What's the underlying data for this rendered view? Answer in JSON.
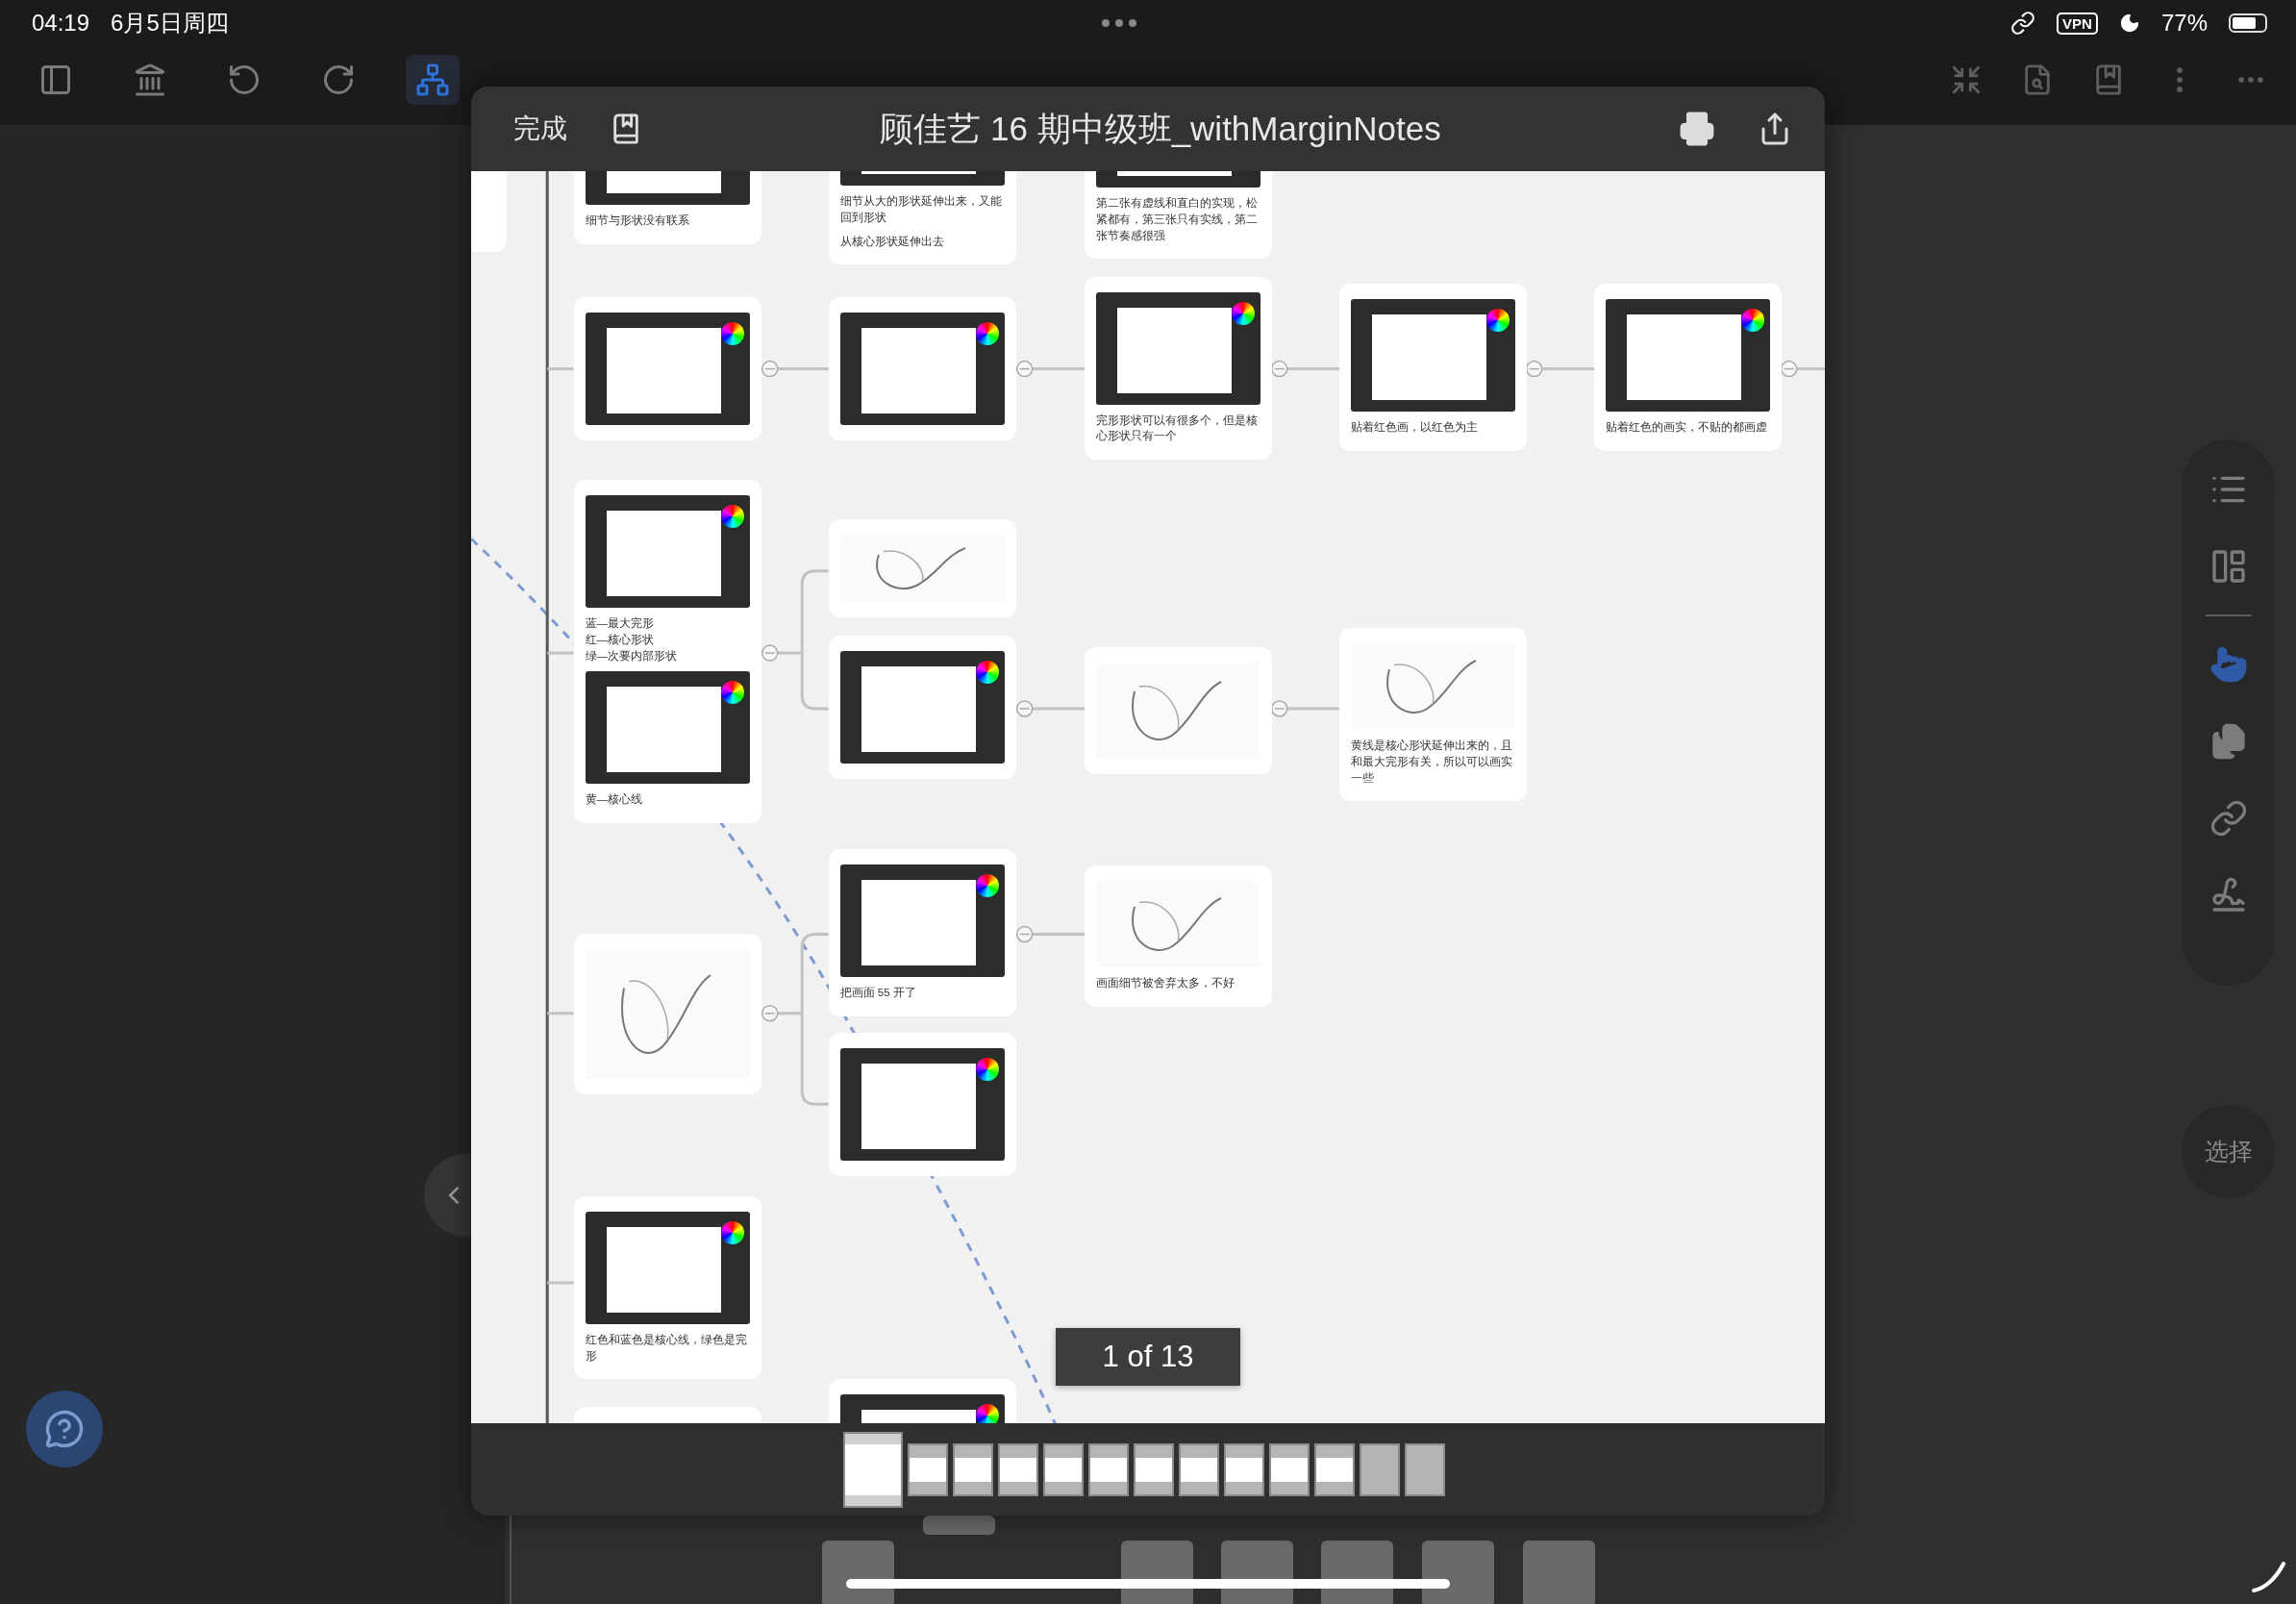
{
  "status_bar": {
    "time": "04:19",
    "date": "6月5日周四",
    "vpn": "VPN",
    "battery": "77%"
  },
  "toolbar": {
    "left": [
      {
        "selected": false
      },
      {
        "selected": false
      },
      {
        "selected": false
      },
      {
        "selected": false
      },
      {
        "selected": true
      }
    ]
  },
  "tool_palette": [
    {
      "selected": false
    },
    {
      "selected": false
    },
    {
      "selected": true
    },
    {
      "selected": false
    },
    {
      "selected": false
    },
    {
      "selected": false
    }
  ],
  "select_button": "选择",
  "preview": {
    "done": "完成",
    "title": "顾佳艺 16 期中级班_withMarginNotes",
    "page_indicator": "1 of 13",
    "nodes": [
      {
        "kind": "stub"
      },
      {
        "blocks": [
          {
            "kind": "screenshot"
          },
          {
            "kind": "text",
            "text": "细节与形状没有联系"
          }
        ]
      },
      {
        "blocks": [
          {
            "kind": "screenshot"
          },
          {
            "kind": "text",
            "text": "细节从大的形状延伸出来，又能回到形状"
          },
          {
            "kind": "text",
            "text": "从核心形状延伸出去"
          }
        ]
      },
      {
        "blocks": [
          {
            "kind": "screenshot"
          },
          {
            "kind": "text",
            "text": "第二张有虚线和直白的实现，松紧都有，第三张只有实线，第二张节奏感很强"
          }
        ]
      },
      {
        "blocks": [
          {
            "kind": "screenshot"
          }
        ]
      },
      {
        "blocks": [
          {
            "kind": "screenshot"
          }
        ]
      },
      {
        "blocks": [
          {
            "kind": "screenshot"
          },
          {
            "kind": "text",
            "text": "完形形状可以有很多个，但是核心形状只有一个"
          }
        ]
      },
      {
        "blocks": [
          {
            "kind": "screenshot"
          },
          {
            "kind": "text",
            "text": "贴着红色画，以红色为主"
          }
        ]
      },
      {
        "blocks": [
          {
            "kind": "screenshot"
          },
          {
            "kind": "text",
            "text": "贴着红色的画实，不贴的都画虚"
          }
        ]
      },
      {
        "blocks": [
          {
            "kind": "screenshot"
          },
          {
            "kind": "text",
            "text": "蓝—最大完形"
          },
          {
            "kind": "line",
            "text": "红—核心形状"
          },
          {
            "kind": "line",
            "text": "绿—次要内部形状"
          },
          {
            "kind": "screenshot"
          },
          {
            "kind": "text",
            "text": "黄—核心线"
          }
        ]
      },
      {
        "blocks": [
          {
            "kind": "sketch"
          }
        ]
      },
      {
        "blocks": [
          {
            "kind": "screenshot"
          }
        ]
      },
      {
        "blocks": [
          {
            "kind": "sketch"
          }
        ]
      },
      {
        "blocks": [
          {
            "kind": "sketch"
          },
          {
            "kind": "text",
            "text": "黄线是核心形状延伸出来的，且和最大完形有关，所以可以画实一些"
          }
        ]
      },
      {
        "blocks": [
          {
            "kind": "sketch"
          }
        ]
      },
      {
        "blocks": [
          {
            "kind": "screenshot"
          },
          {
            "kind": "text",
            "text": "把画面 55 开了"
          }
        ]
      },
      {
        "blocks": [
          {
            "kind": "sketch"
          },
          {
            "kind": "text",
            "text": "画面细节被舍弃太多，不好"
          }
        ]
      },
      {
        "blocks": [
          {
            "kind": "screenshot"
          }
        ]
      },
      {
        "blocks": [
          {
            "kind": "screenshot"
          },
          {
            "kind": "text",
            "text": "红色和蓝色是核心线，绿色是完形"
          }
        ]
      },
      {
        "kind": "stub"
      },
      {
        "blocks": [
          {
            "kind": "screenshot"
          }
        ]
      }
    ],
    "pages": [
      {
        "selected": true,
        "loaded": true
      },
      {
        "selected": false,
        "loaded": true
      },
      {
        "selected": false,
        "loaded": true
      },
      {
        "selected": false,
        "loaded": true
      },
      {
        "selected": false,
        "loaded": true
      },
      {
        "selected": false,
        "loaded": true
      },
      {
        "selected": false,
        "loaded": true
      },
      {
        "selected": false,
        "loaded": true
      },
      {
        "selected": false,
        "loaded": true
      },
      {
        "selected": false,
        "loaded": true
      },
      {
        "selected": false,
        "loaded": true
      },
      {
        "selected": false,
        "loaded": false
      },
      {
        "selected": false,
        "loaded": false
      }
    ]
  }
}
